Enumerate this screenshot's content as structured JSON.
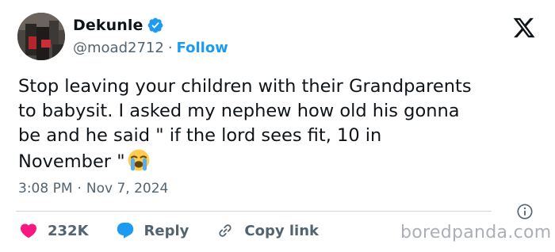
{
  "author": {
    "name": "Dekunle",
    "handle": "@moad2712",
    "separator": "·",
    "follow_label": "Follow"
  },
  "tweet": {
    "text": "Stop leaving your children with their Grandparents\nto babysit. I asked my nephew how old his gonna\nbe and he said \" if the lord sees fit, 10 in\nNovember \"",
    "emoji": "loudly-crying-face-emoji",
    "time": "3:08 PM",
    "date": "Nov 7, 2024",
    "separator": "·"
  },
  "actions": {
    "likes_count": "232K",
    "reply_label": "Reply",
    "copy_link_label": "Copy link"
  },
  "watermark": "boredpanda.com",
  "colors": {
    "accent": "#1d9bf0",
    "like": "#f91880",
    "text": "#0f1419",
    "muted": "#536471"
  },
  "icons": [
    "verified-badge-icon",
    "x-logo-icon",
    "info-icon",
    "heart-icon",
    "reply-bubble-icon",
    "link-icon"
  ]
}
